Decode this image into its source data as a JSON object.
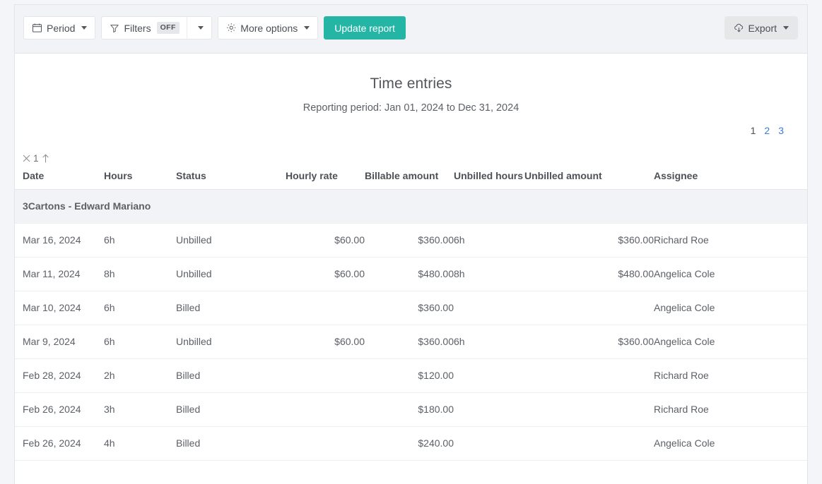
{
  "toolbar": {
    "period_label": "Period",
    "filters_label": "Filters",
    "filters_state": "OFF",
    "more_options_label": "More options",
    "update_report_label": "Update report",
    "export_label": "Export",
    "accent_color": "#25b5a5"
  },
  "report": {
    "title": "Time entries",
    "subtitle": "Reporting period: Jan 01, 2024 to Dec 31, 2024"
  },
  "pagination": {
    "pages": [
      "1",
      "2",
      "3"
    ],
    "current": "1",
    "link_color": "#3b7dd8"
  },
  "sort": {
    "remove_label": "✕",
    "index": "1",
    "direction": "↑"
  },
  "table": {
    "columns": [
      "Date",
      "Hours",
      "Status",
      "Hourly rate",
      "Billable amount",
      "Unbilled hours",
      "Unbilled amount",
      "Assignee"
    ],
    "group_label": "3Cartons - Edward Mariano",
    "rows": [
      {
        "date": "Mar 16, 2024",
        "hours": "6h",
        "status": "Unbilled",
        "hourly_rate": "$60.00",
        "billable_amount": "$360.00",
        "unbilled_hours": "6h",
        "unbilled_amount": "$360.00",
        "assignee": "Richard Roe"
      },
      {
        "date": "Mar 11, 2024",
        "hours": "8h",
        "status": "Unbilled",
        "hourly_rate": "$60.00",
        "billable_amount": "$480.00",
        "unbilled_hours": "8h",
        "unbilled_amount": "$480.00",
        "assignee": "Angelica Cole"
      },
      {
        "date": "Mar 10, 2024",
        "hours": "6h",
        "status": "Billed",
        "hourly_rate": "",
        "billable_amount": "$360.00",
        "unbilled_hours": "",
        "unbilled_amount": "",
        "assignee": "Angelica Cole"
      },
      {
        "date": "Mar 9, 2024",
        "hours": "6h",
        "status": "Unbilled",
        "hourly_rate": "$60.00",
        "billable_amount": "$360.00",
        "unbilled_hours": "6h",
        "unbilled_amount": "$360.00",
        "assignee": "Angelica Cole"
      },
      {
        "date": "Feb 28, 2024",
        "hours": "2h",
        "status": "Billed",
        "hourly_rate": "",
        "billable_amount": "$120.00",
        "unbilled_hours": "",
        "unbilled_amount": "",
        "assignee": "Richard Roe"
      },
      {
        "date": "Feb 26, 2024",
        "hours": "3h",
        "status": "Billed",
        "hourly_rate": "",
        "billable_amount": "$180.00",
        "unbilled_hours": "",
        "unbilled_amount": "",
        "assignee": "Richard Roe"
      },
      {
        "date": "Feb 26, 2024",
        "hours": "4h",
        "status": "Billed",
        "hourly_rate": "",
        "billable_amount": "$240.00",
        "unbilled_hours": "",
        "unbilled_amount": "",
        "assignee": "Angelica Cole"
      }
    ]
  }
}
